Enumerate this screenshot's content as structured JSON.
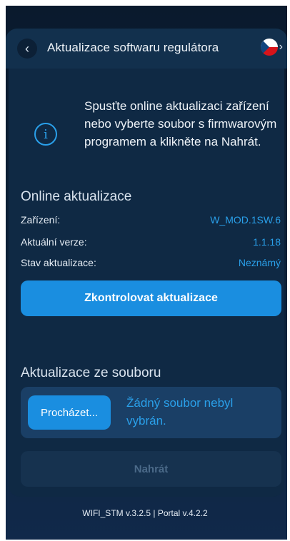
{
  "header": {
    "back_icon": "chevron-left-icon",
    "title": "Aktualizace softwaru regulátora",
    "language_flag": "czech-flag-icon",
    "language_chevron": "chevron-right-icon"
  },
  "info": {
    "icon": "info-icon",
    "text": "Spusťte online aktualizaci zařízení nebo vyberte soubor s firmwarovým programem a klikněte na Nahrát."
  },
  "online_update": {
    "title": "Online aktualizace",
    "rows": [
      {
        "label": "Zařízení:",
        "value": "W_MOD.1SW.6"
      },
      {
        "label": "Aktuální verze:",
        "value": "1.1.18"
      },
      {
        "label": "Stav aktualizace:",
        "value": "Neznámý"
      }
    ],
    "check_button": "Zkontrolovat aktualizace"
  },
  "file_update": {
    "title": "Aktualizace ze souboru",
    "browse_button": "Procházet...",
    "file_status": "Žádný soubor nebyl vybrán.",
    "upload_button": "Nahrát"
  },
  "footer": {
    "version_text": "WIFI_STM v.3.2.5 | Portal v.4.2.2"
  },
  "colors": {
    "accent": "#1a8ee0",
    "link": "#2aa0ea",
    "background": "#0d2239",
    "card": "#0f2944"
  }
}
